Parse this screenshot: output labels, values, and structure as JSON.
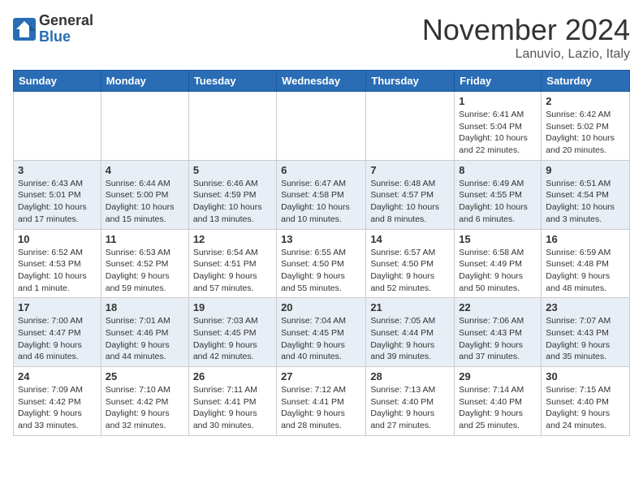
{
  "header": {
    "logo_general": "General",
    "logo_blue": "Blue",
    "month_title": "November 2024",
    "location": "Lanuvio, Lazio, Italy"
  },
  "weekdays": [
    "Sunday",
    "Monday",
    "Tuesday",
    "Wednesday",
    "Thursday",
    "Friday",
    "Saturday"
  ],
  "weeks": [
    [
      {
        "day": "",
        "info": ""
      },
      {
        "day": "",
        "info": ""
      },
      {
        "day": "",
        "info": ""
      },
      {
        "day": "",
        "info": ""
      },
      {
        "day": "",
        "info": ""
      },
      {
        "day": "1",
        "info": "Sunrise: 6:41 AM\nSunset: 5:04 PM\nDaylight: 10 hours\nand 22 minutes."
      },
      {
        "day": "2",
        "info": "Sunrise: 6:42 AM\nSunset: 5:02 PM\nDaylight: 10 hours\nand 20 minutes."
      }
    ],
    [
      {
        "day": "3",
        "info": "Sunrise: 6:43 AM\nSunset: 5:01 PM\nDaylight: 10 hours\nand 17 minutes."
      },
      {
        "day": "4",
        "info": "Sunrise: 6:44 AM\nSunset: 5:00 PM\nDaylight: 10 hours\nand 15 minutes."
      },
      {
        "day": "5",
        "info": "Sunrise: 6:46 AM\nSunset: 4:59 PM\nDaylight: 10 hours\nand 13 minutes."
      },
      {
        "day": "6",
        "info": "Sunrise: 6:47 AM\nSunset: 4:58 PM\nDaylight: 10 hours\nand 10 minutes."
      },
      {
        "day": "7",
        "info": "Sunrise: 6:48 AM\nSunset: 4:57 PM\nDaylight: 10 hours\nand 8 minutes."
      },
      {
        "day": "8",
        "info": "Sunrise: 6:49 AM\nSunset: 4:55 PM\nDaylight: 10 hours\nand 6 minutes."
      },
      {
        "day": "9",
        "info": "Sunrise: 6:51 AM\nSunset: 4:54 PM\nDaylight: 10 hours\nand 3 minutes."
      }
    ],
    [
      {
        "day": "10",
        "info": "Sunrise: 6:52 AM\nSunset: 4:53 PM\nDaylight: 10 hours\nand 1 minute."
      },
      {
        "day": "11",
        "info": "Sunrise: 6:53 AM\nSunset: 4:52 PM\nDaylight: 9 hours\nand 59 minutes."
      },
      {
        "day": "12",
        "info": "Sunrise: 6:54 AM\nSunset: 4:51 PM\nDaylight: 9 hours\nand 57 minutes."
      },
      {
        "day": "13",
        "info": "Sunrise: 6:55 AM\nSunset: 4:50 PM\nDaylight: 9 hours\nand 55 minutes."
      },
      {
        "day": "14",
        "info": "Sunrise: 6:57 AM\nSunset: 4:50 PM\nDaylight: 9 hours\nand 52 minutes."
      },
      {
        "day": "15",
        "info": "Sunrise: 6:58 AM\nSunset: 4:49 PM\nDaylight: 9 hours\nand 50 minutes."
      },
      {
        "day": "16",
        "info": "Sunrise: 6:59 AM\nSunset: 4:48 PM\nDaylight: 9 hours\nand 48 minutes."
      }
    ],
    [
      {
        "day": "17",
        "info": "Sunrise: 7:00 AM\nSunset: 4:47 PM\nDaylight: 9 hours\nand 46 minutes."
      },
      {
        "day": "18",
        "info": "Sunrise: 7:01 AM\nSunset: 4:46 PM\nDaylight: 9 hours\nand 44 minutes."
      },
      {
        "day": "19",
        "info": "Sunrise: 7:03 AM\nSunset: 4:45 PM\nDaylight: 9 hours\nand 42 minutes."
      },
      {
        "day": "20",
        "info": "Sunrise: 7:04 AM\nSunset: 4:45 PM\nDaylight: 9 hours\nand 40 minutes."
      },
      {
        "day": "21",
        "info": "Sunrise: 7:05 AM\nSunset: 4:44 PM\nDaylight: 9 hours\nand 39 minutes."
      },
      {
        "day": "22",
        "info": "Sunrise: 7:06 AM\nSunset: 4:43 PM\nDaylight: 9 hours\nand 37 minutes."
      },
      {
        "day": "23",
        "info": "Sunrise: 7:07 AM\nSunset: 4:43 PM\nDaylight: 9 hours\nand 35 minutes."
      }
    ],
    [
      {
        "day": "24",
        "info": "Sunrise: 7:09 AM\nSunset: 4:42 PM\nDaylight: 9 hours\nand 33 minutes."
      },
      {
        "day": "25",
        "info": "Sunrise: 7:10 AM\nSunset: 4:42 PM\nDaylight: 9 hours\nand 32 minutes."
      },
      {
        "day": "26",
        "info": "Sunrise: 7:11 AM\nSunset: 4:41 PM\nDaylight: 9 hours\nand 30 minutes."
      },
      {
        "day": "27",
        "info": "Sunrise: 7:12 AM\nSunset: 4:41 PM\nDaylight: 9 hours\nand 28 minutes."
      },
      {
        "day": "28",
        "info": "Sunrise: 7:13 AM\nSunset: 4:40 PM\nDaylight: 9 hours\nand 27 minutes."
      },
      {
        "day": "29",
        "info": "Sunrise: 7:14 AM\nSunset: 4:40 PM\nDaylight: 9 hours\nand 25 minutes."
      },
      {
        "day": "30",
        "info": "Sunrise: 7:15 AM\nSunset: 4:40 PM\nDaylight: 9 hours\nand 24 minutes."
      }
    ]
  ]
}
